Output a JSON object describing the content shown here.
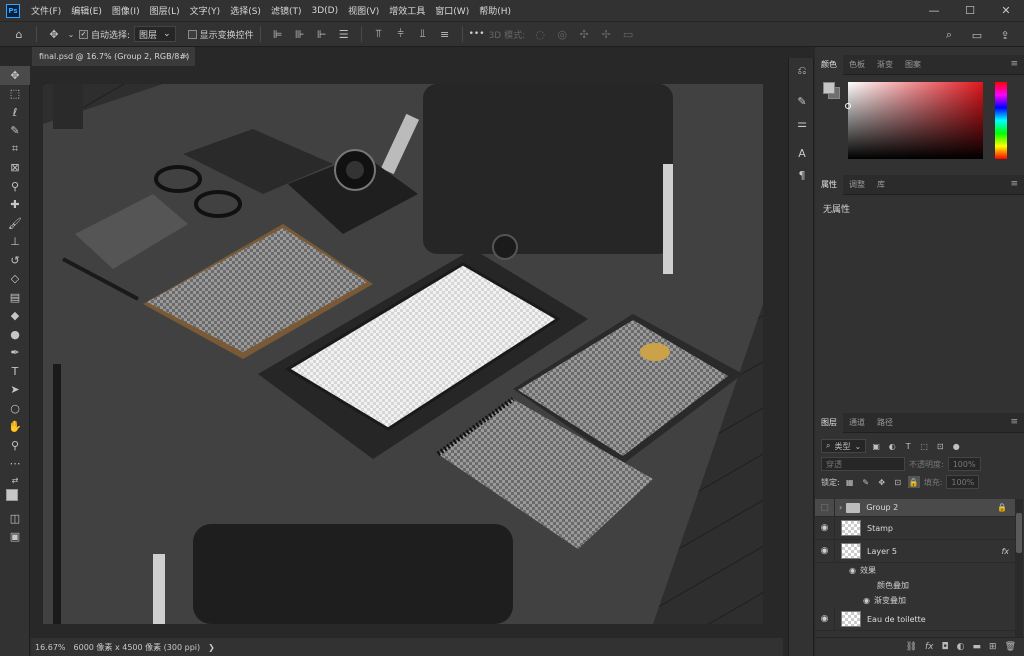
{
  "app": {
    "logo": "Ps"
  },
  "menu": [
    "文件(F)",
    "编辑(E)",
    "图像(I)",
    "图层(L)",
    "文字(Y)",
    "选择(S)",
    "滤镜(T)",
    "3D(D)",
    "视图(V)",
    "增效工具",
    "窗口(W)",
    "帮助(H)"
  ],
  "window_controls": {
    "minimize": "—",
    "maximize": "☐",
    "close": "✕"
  },
  "options": {
    "auto_select_label": "自动选择:",
    "auto_select_value": "图层",
    "show_transform_label": "显示变换控件",
    "more": "•••",
    "mode_3d_label": "3D 模式:"
  },
  "document": {
    "tab_title": "final.psd @ 16.7% (Group 2, RGB/8#)",
    "close": "×"
  },
  "status": {
    "zoom": "16.67%",
    "dimensions": "6000 像素 x 4500 像素 (300 ppi)",
    "arrow": "❯"
  },
  "panels": {
    "color_tabs": [
      "颜色",
      "色板",
      "渐变",
      "图案"
    ],
    "props_tabs": [
      "属性",
      "调整",
      "库"
    ],
    "props_empty": "无属性",
    "layers_tabs": [
      "图层",
      "通道",
      "路径"
    ]
  },
  "layers": {
    "filter_kind": "类型",
    "blend_mode": "穿透",
    "opacity_label": "不透明度:",
    "opacity_value": "100%",
    "lock_label": "锁定:",
    "fill_label": "填充:",
    "fill_value": "100%",
    "items": [
      {
        "name": "Group 2"
      },
      {
        "name": "Stamp"
      },
      {
        "name": "Layer 5",
        "fx": "fx"
      },
      {
        "name": "Eau de toilette"
      }
    ],
    "effects_label": "效果",
    "effects": [
      "颜色叠加",
      "渐变叠加"
    ]
  },
  "colors": {
    "accent": "#31a8ff",
    "panel": "#323232",
    "selected": "#4a4a4a"
  }
}
